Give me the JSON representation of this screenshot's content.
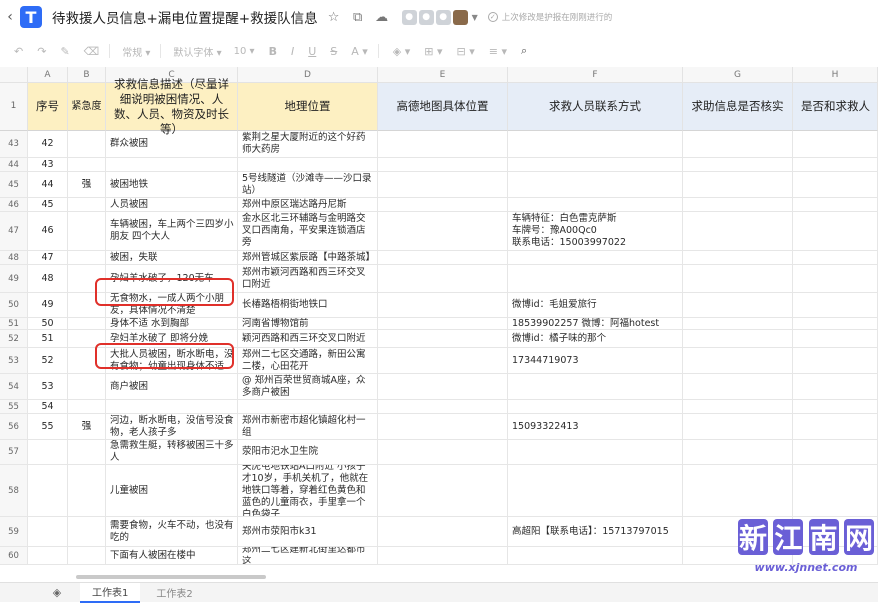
{
  "titlebar": {
    "back_icon": "chevron-left-icon",
    "logo_text": "T",
    "title": "待救援人员信息+漏电位置提醒+救援队信息",
    "save_status": "上次修改是护报在刚刚进行的"
  },
  "toolbar": {
    "style_label": "常规",
    "font_label": "默认字体",
    "size_label": "10"
  },
  "columns": [
    "A",
    "B",
    "C",
    "D",
    "E",
    "F",
    "G",
    "H"
  ],
  "header": {
    "rownum": "1",
    "a": "序号",
    "b": "紧急度",
    "c": "求救信息描述（尽量详细说明被困情况、人数、人员、物资及时长等）",
    "d": "地理位置",
    "e": "高德地图具体位置",
    "f": "求救人员联系方式",
    "g": "求助信息是否核实",
    "h": "是否和求救人"
  },
  "rows": [
    {
      "rn": "43",
      "a": "42",
      "b": "",
      "c": "群众被困",
      "d": "紫荆之星大厦附近的这个好药师大药房",
      "e": "",
      "f": "",
      "g": ""
    },
    {
      "rn": "44",
      "a": "43",
      "b": "",
      "c": "",
      "d": "",
      "e": "",
      "f": "",
      "g": ""
    },
    {
      "rn": "45",
      "a": "44",
      "b": "强",
      "c": "被困地铁",
      "d": "5号线隧道（沙滩寺——沙口录站）",
      "e": "",
      "f": "",
      "g": ""
    },
    {
      "rn": "46",
      "a": "45",
      "b": "",
      "c": "人员被困",
      "d": "郑州中原区瑞达路丹尼斯",
      "e": "",
      "f": "",
      "g": ""
    },
    {
      "rn": "47",
      "a": "46",
      "b": "",
      "c": "车辆被困，车上两个三四岁小朋友 四个大人",
      "d": "金水区北三环辅路与金明路交叉口西南角，平安果连锁酒店旁",
      "e": "",
      "f": "车辆特征：白色雷克萨斯\n车牌号：豫A00Qc0\n联系电话：15003997022",
      "g": ""
    },
    {
      "rn": "48",
      "a": "47",
      "b": "",
      "c": "被困，失联",
      "d": "郑州管城区紫辰路【中路茶城】",
      "e": "",
      "f": "",
      "g": ""
    },
    {
      "rn": "49",
      "a": "48",
      "b": "",
      "c": "孕妇羊水破了，120无车",
      "d": "郑州市颖河西路和西三环交叉口附近",
      "e": "",
      "f": "",
      "g": ""
    },
    {
      "rn": "50",
      "a": "49",
      "b": "",
      "c": "无食物水，一成人两个小朋友，具体情况不清楚",
      "d": "长椿路梧桐街地铁口",
      "e": "",
      "f": "微博id：毛姐爱旅行",
      "g": ""
    },
    {
      "rn": "51",
      "a": "50",
      "b": "",
      "c": "身体不适 水到胸部",
      "d": "河南省博物馆前",
      "e": "",
      "f": "18539902257 微博：阿福hotest",
      "g": ""
    },
    {
      "rn": "52",
      "a": "51",
      "b": "",
      "c": "孕妇羊水破了 即将分娩",
      "d": "颖河西路和西三环交叉口附近",
      "e": "",
      "f": "微博id：橘子味的那个",
      "g": ""
    },
    {
      "rn": "53",
      "a": "52",
      "b": "",
      "c": "大批人员被困，断水断电，没有食物；幼童出现身体不适",
      "d": "郑州二七区交通路，新田公寓二楼，心田花开",
      "e": "",
      "f": "17344719073",
      "g": ""
    },
    {
      "rn": "54",
      "a": "53",
      "b": "",
      "c": "商户被困",
      "d": "@ 郑州百荣世贸商城A座，众多商户被困",
      "e": "",
      "f": "",
      "g": ""
    },
    {
      "rn": "55",
      "a": "54",
      "b": "",
      "c": "",
      "d": "",
      "e": "",
      "f": "",
      "g": ""
    },
    {
      "rn": "56",
      "a": "55",
      "b": "强",
      "c": "河边，断水断电，没信号没食物，老人孩子多",
      "d": "郑州市新密市超化镇超化村一组",
      "e": "",
      "f": "15093322413",
      "g": ""
    },
    {
      "rn": "57",
      "a": "",
      "b": "",
      "c": "急需救生艇，转移被困三十多人",
      "d": "荥阳市汜水卫生院",
      "e": "",
      "f": "",
      "g": ""
    },
    {
      "rn": "58",
      "a": "",
      "b": "",
      "c": "儿童被困",
      "d": "关虎屯地铁站A口附近 小孩子才10岁，手机关机了，他就在地铁口等着，穿着红色黄色和蓝色的儿童雨衣，手里拿一个白色袋子",
      "e": "",
      "f": "",
      "g": ""
    },
    {
      "rn": "59",
      "a": "",
      "b": "",
      "c": "需要食物，火车不动，也没有吃的",
      "d": "郑州市荥阳市k31",
      "e": "",
      "f": "高超阳【联系电话】：15713797015",
      "g": ""
    },
    {
      "rn": "60",
      "a": "",
      "b": "",
      "c": "下面有人被困在楼中",
      "d": "郑州二七区建新北街里达都市这",
      "e": "",
      "f": "",
      "g": ""
    }
  ],
  "sheets": [
    "工作表1",
    "工作表2"
  ],
  "watermark": {
    "chars": [
      "新",
      "江",
      "南",
      "网"
    ],
    "url": "www.xjnnet.com"
  }
}
